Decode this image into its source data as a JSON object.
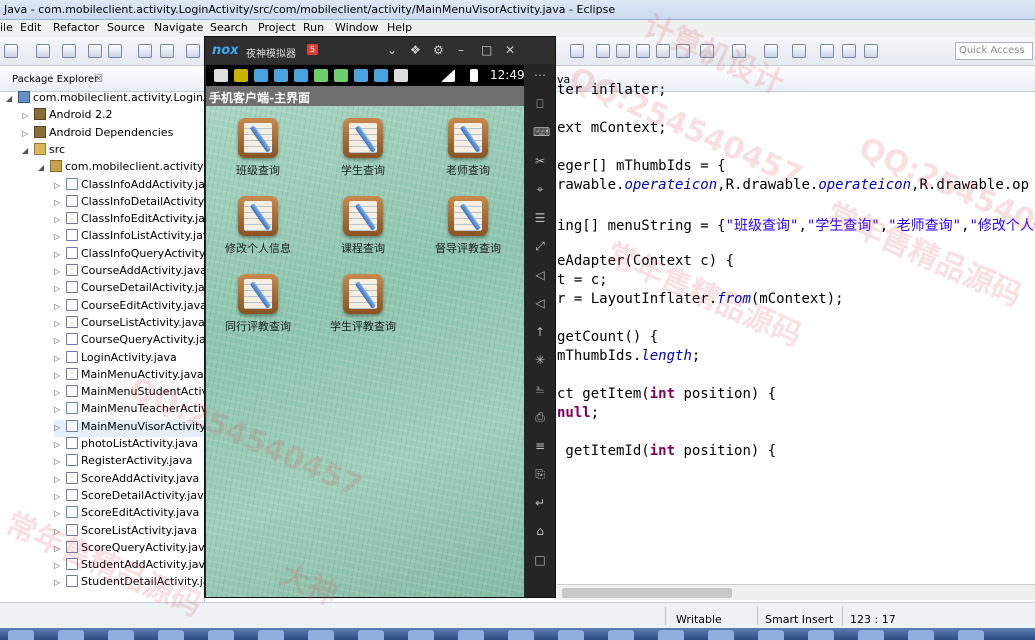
{
  "window": {
    "title": "Java - com.mobileclient.activity.LoginActivity/src/com/mobileclient/activity/MainMenuVisorActivity.java - Eclipse"
  },
  "menu": [
    "ile",
    "Edit",
    "Refactor",
    "Source",
    "Navigate",
    "Search",
    "Project",
    "Run",
    "Window",
    "Help"
  ],
  "toolbar": {
    "quick_access_placeholder": "Quick Access"
  },
  "package_explorer": {
    "tab_label": "Package Explorer",
    "close_glyph": "☒",
    "rows": [
      {
        "text": "com.mobileclient.activity.LoginActivity",
        "level": 0,
        "expander": "◢",
        "icon": "project-icon"
      },
      {
        "text": "Android 2.2",
        "level": 1,
        "expander": "▷",
        "icon": "library-icon"
      },
      {
        "text": "Android Dependencies",
        "level": 1,
        "expander": "▷",
        "icon": "library-icon"
      },
      {
        "text": "src",
        "level": 1,
        "expander": "◢",
        "icon": "source-folder-icon"
      },
      {
        "text": "com.mobileclient.activity",
        "level": 2,
        "expander": "◢",
        "icon": "package-icon"
      },
      {
        "text": "ClassInfoAddActivity.java",
        "level": 3,
        "expander": "▷",
        "icon": "java-file-icon"
      },
      {
        "text": "ClassInfoDetailActivity.java",
        "level": 3,
        "expander": "▷",
        "icon": "java-file-icon"
      },
      {
        "text": "ClassInfoEditActivity.java",
        "level": 3,
        "expander": "▷",
        "icon": "java-file-icon"
      },
      {
        "text": "ClassInfoListActivity.java",
        "level": 3,
        "expander": "▷",
        "icon": "java-file-icon"
      },
      {
        "text": "ClassInfoQueryActivity.java",
        "level": 3,
        "expander": "▷",
        "icon": "java-file-icon"
      },
      {
        "text": "CourseAddActivity.java",
        "level": 3,
        "expander": "▷",
        "icon": "java-file-icon"
      },
      {
        "text": "CourseDetailActivity.java",
        "level": 3,
        "expander": "▷",
        "icon": "java-file-icon"
      },
      {
        "text": "CourseEditActivity.java",
        "level": 3,
        "expander": "▷",
        "icon": "java-file-icon"
      },
      {
        "text": "CourseListActivity.java",
        "level": 3,
        "expander": "▷",
        "icon": "java-file-icon"
      },
      {
        "text": "CourseQueryActivity.java",
        "level": 3,
        "expander": "▷",
        "icon": "java-file-icon"
      },
      {
        "text": "LoginActivity.java",
        "level": 3,
        "expander": "▷",
        "icon": "java-file-icon"
      },
      {
        "text": "MainMenuActivity.java",
        "level": 3,
        "expander": "▷",
        "icon": "java-file-icon"
      },
      {
        "text": "MainMenuStudentActivity.java",
        "level": 3,
        "expander": "▷",
        "icon": "java-file-icon"
      },
      {
        "text": "MainMenuTeacherActivity.java",
        "level": 3,
        "expander": "▷",
        "icon": "java-file-icon"
      },
      {
        "text": "MainMenuVisorActivity.java",
        "level": 3,
        "expander": "▷",
        "icon": "java-file-icon"
      },
      {
        "text": "photoListActivity.java",
        "level": 3,
        "expander": "▷",
        "icon": "java-file-icon"
      },
      {
        "text": "RegisterActivity.java",
        "level": 3,
        "expander": "▷",
        "icon": "java-file-icon"
      },
      {
        "text": "ScoreAddActivity.java",
        "level": 3,
        "expander": "▷",
        "icon": "java-file-icon"
      },
      {
        "text": "ScoreDetailActivity.java",
        "level": 3,
        "expander": "▷",
        "icon": "java-file-icon"
      },
      {
        "text": "ScoreEditActivity.java",
        "level": 3,
        "expander": "▷",
        "icon": "java-file-icon"
      },
      {
        "text": "ScoreListActivity.java",
        "level": 3,
        "expander": "▷",
        "icon": "java-file-icon"
      },
      {
        "text": "ScoreQueryActivity.java",
        "level": 3,
        "expander": "▷",
        "icon": "java-file-icon"
      },
      {
        "text": "StudentAddActivity.java",
        "level": 3,
        "expander": "▷",
        "icon": "java-file-icon"
      },
      {
        "text": "StudentDetailActivity.java",
        "level": 3,
        "expander": "▷",
        "icon": "java-file-icon"
      }
    ]
  },
  "editor": {
    "tab_label": "va",
    "lines": [
      [
        {
          "t": "ter inflater;"
        }
      ],
      [],
      [
        {
          "t": "ext mContext;"
        }
      ],
      [],
      [
        {
          "t": "eger[] mThumbIds = {"
        }
      ],
      [
        {
          "t": "rawable."
        },
        {
          "t": "operateicon",
          "c": "it"
        },
        {
          "t": ",R.drawable."
        },
        {
          "t": "operateicon",
          "c": "it"
        },
        {
          "t": ",R.drawable.op"
        }
      ],
      [],
      [
        {
          "t": "ing[] menuString = {"
        },
        {
          "t": "\"班级查询\"",
          "c": "str"
        },
        {
          "t": ","
        },
        {
          "t": "\"学生查询\"",
          "c": "str"
        },
        {
          "t": ","
        },
        {
          "t": "\"老师查询\"",
          "c": "str"
        },
        {
          "t": ","
        },
        {
          "t": "\"修改个人信息",
          "c": "str"
        }
      ],
      [],
      [
        {
          "t": "eAdapter(Context c) {"
        }
      ],
      [
        {
          "t": "t = c;"
        }
      ],
      [
        {
          "t": "r = LayoutInflater."
        },
        {
          "t": "from",
          "c": "it"
        },
        {
          "t": "(mContext);"
        }
      ],
      [],
      [
        {
          "t": "getCount() {"
        }
      ],
      [
        {
          "t": "mThumbIds."
        },
        {
          "t": "length",
          "c": "it"
        },
        {
          "t": ";"
        }
      ],
      [],
      [
        {
          "t": "ct getItem("
        },
        {
          "t": "int",
          "c": "kw"
        },
        {
          "t": " position) {"
        }
      ],
      [
        {
          "t": "null",
          "c": "kw"
        },
        {
          "t": ";"
        }
      ],
      [],
      [
        {
          "t": " getItemId("
        },
        {
          "t": "int",
          "c": "kw"
        },
        {
          "t": " position) {"
        }
      ]
    ]
  },
  "statusbar": {
    "writable": "Writable",
    "insert_mode": "Smart Insert",
    "position": "123 : 17"
  },
  "emulator": {
    "logo": "nox",
    "name": "夜神模拟器",
    "badge": "5",
    "clock": "12:49",
    "app_title": "手机客户端-主界面",
    "menu_items": [
      "班级查询",
      "学生查询",
      "老师查询",
      "修改个人信息",
      "课程查询",
      "督导评教查询",
      "同行评教查询",
      "学生评教查询"
    ],
    "controls": [
      "⌄",
      "❖",
      "⚙",
      "–",
      "□",
      "✕"
    ],
    "sidebar_icons": [
      "⋯",
      "⎕",
      "⌨",
      "✂",
      "⌖",
      "☰",
      "⤢",
      "◁",
      "◁",
      "↑",
      "✳",
      "⎁",
      "⎙",
      "≡",
      "⎘",
      "↵",
      "⌂",
      "□"
    ]
  },
  "watermarks": [
    "QQ:254540457",
    "常年售精品源码",
    "计算机设计",
    "大神",
    "QQ:254540457",
    "常年售精品源码",
    "QQ:254540457",
    "常年售精品源码"
  ]
}
